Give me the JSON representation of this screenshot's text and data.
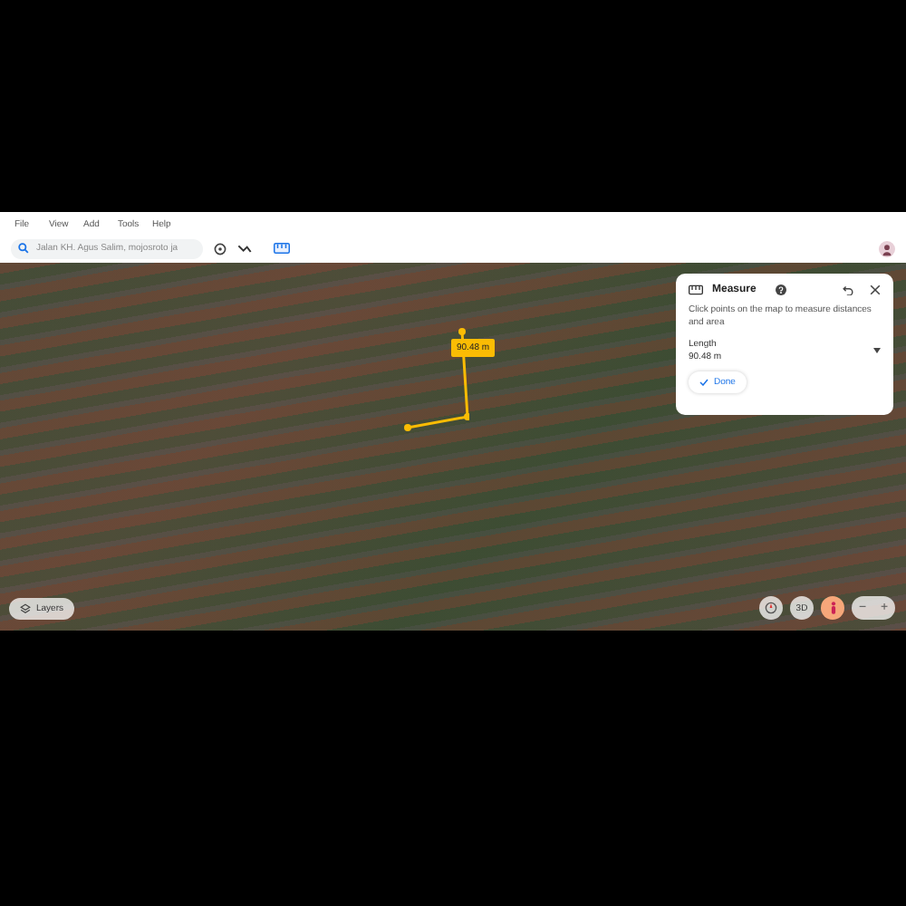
{
  "menu": [
    "File",
    "View",
    "Add",
    "Tools",
    "Help"
  ],
  "search": {
    "placeholder": "Jalan KH. Agus Salim, mojosroto ja"
  },
  "measure_panel": {
    "title": "Measure",
    "instructions": "Click points on the map to measure distances and area",
    "length_label": "Length",
    "length_value": "90.48 m",
    "done_label": "Done"
  },
  "map": {
    "distance_label": "90.48 m",
    "layers_label": "Layers",
    "view_toggle": "3D"
  },
  "zoom_controls": [
    "−",
    "+"
  ]
}
